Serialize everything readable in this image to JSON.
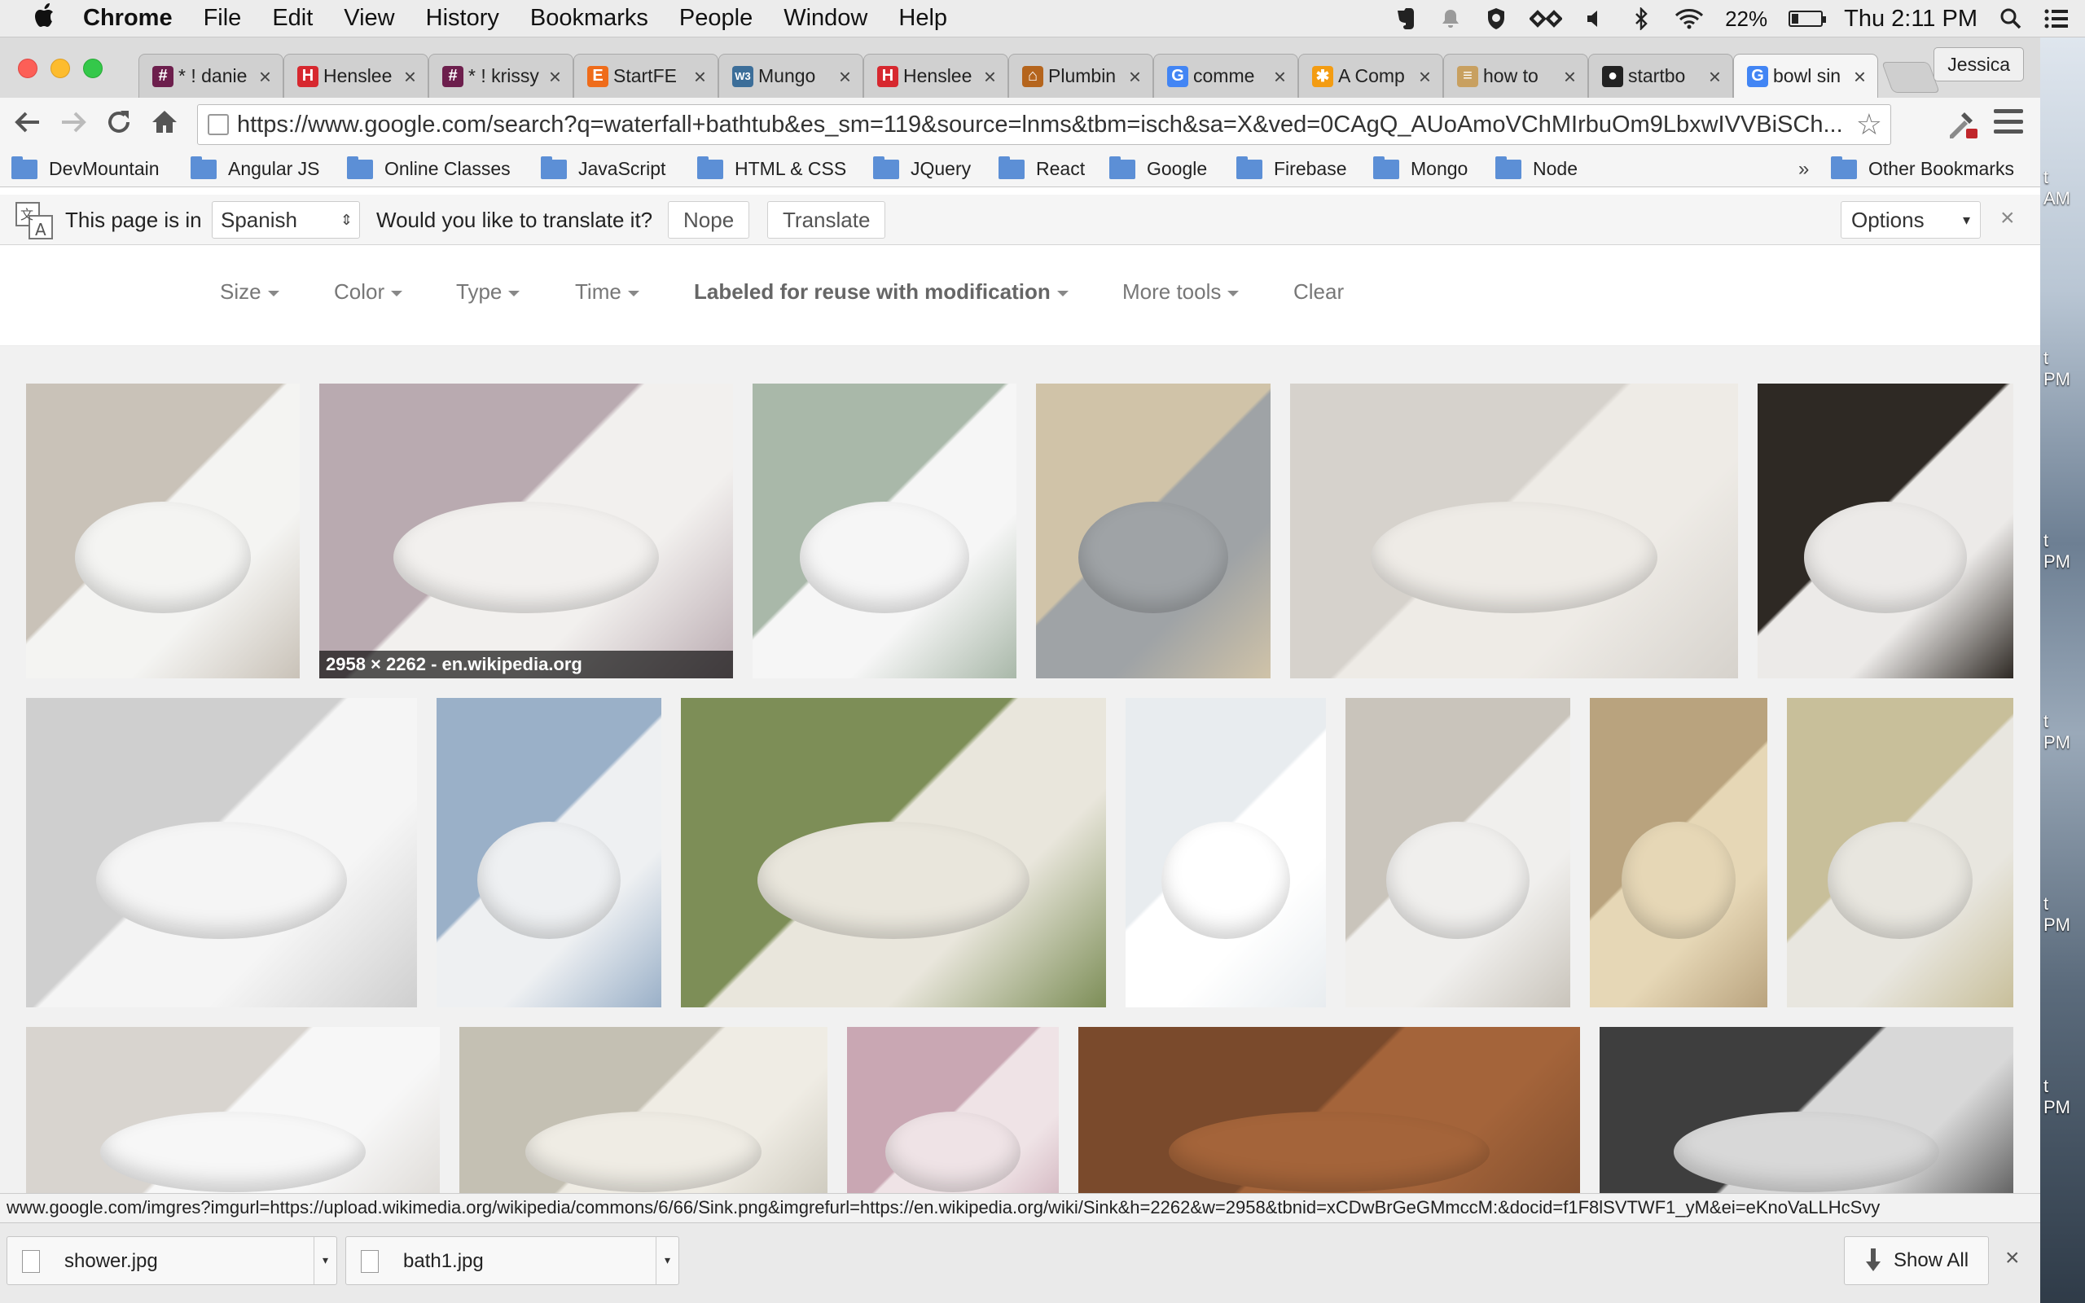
{
  "menubar": {
    "app": "Chrome",
    "items": [
      "File",
      "Edit",
      "View",
      "History",
      "Bookmarks",
      "People",
      "Window",
      "Help"
    ],
    "battery": "22%",
    "battery_level": 0.22,
    "clock": "Thu 2:11 PM"
  },
  "tabs": [
    {
      "title": "* ! danie",
      "favicon": "slack-icon",
      "color": "#6d1f4d",
      "glyph": "#"
    },
    {
      "title": "Henslee",
      "favicon": "h-icon",
      "color": "#d7282f",
      "glyph": "H"
    },
    {
      "title": "* ! krissy",
      "favicon": "slack-icon",
      "color": "#6d1f4d",
      "glyph": "#"
    },
    {
      "title": "StartFE",
      "favicon": "e-icon",
      "color": "#ef6c1a",
      "glyph": "E"
    },
    {
      "title": "Mungo",
      "favicon": "w3-icon",
      "color": "#3c6e99",
      "glyph": "W3"
    },
    {
      "title": "Henslee",
      "favicon": "h-icon",
      "color": "#d7282f",
      "glyph": "H"
    },
    {
      "title": "Plumbin",
      "favicon": "house-icon",
      "color": "#b5651d",
      "glyph": "⌂"
    },
    {
      "title": "comme",
      "favicon": "google-icon",
      "color": "#4285f4",
      "glyph": "G"
    },
    {
      "title": "A Comp",
      "favicon": "asterisk-icon",
      "color": "#f39c12",
      "glyph": "✱"
    },
    {
      "title": "how to",
      "favicon": "doc-icon",
      "color": "#c8a060",
      "glyph": "≡"
    },
    {
      "title": "startbo",
      "favicon": "github-icon",
      "color": "#222222",
      "glyph": "●"
    },
    {
      "title": "bowl sin",
      "favicon": "google-icon",
      "color": "#4285f4",
      "glyph": "G",
      "active": true
    }
  ],
  "profile": "Jessica",
  "omnibox": {
    "url": "https://www.google.com/search?q=waterfall+bathtub&es_sm=119&source=lnms&tbm=isch&sa=X&ved=0CAgQ_AUoAmoVChMIrbuOm9LbxwIVVBiSCh..."
  },
  "bookmarks": [
    "DevMountain",
    "Angular JS",
    "Online Classes",
    "JavaScript",
    "HTML & CSS",
    "JQuery",
    "React",
    "Google",
    "Firebase",
    "Mongo",
    "Node"
  ],
  "bookmarks_overflow": "»",
  "other_bookmarks": "Other Bookmarks",
  "translate": {
    "prefix": "This page is in",
    "language": "Spanish",
    "question": "Would you like to translate it?",
    "nope": "Nope",
    "translate": "Translate",
    "options": "Options"
  },
  "search_tools": [
    "Size",
    "Color",
    "Type",
    "Time",
    "Labeled for reuse with modification",
    "More tools",
    "Clear"
  ],
  "images": [
    {
      "name": "white-vessel-sink-granite",
      "bg": "#c9c2b8",
      "accent": "#f4f4f2"
    },
    {
      "name": "oval-sink-floral-wallpaper",
      "bg": "#b9aab0",
      "accent": "#f2f0ee",
      "caption": "2958 × 2262 - en.wikipedia.org"
    },
    {
      "name": "round-sink-chrome-faucet",
      "bg": "#a9b8a9",
      "accent": "#f6f6f6"
    },
    {
      "name": "stainless-sink-mosaic",
      "bg": "#d0c3a8",
      "accent": "#9fa3a6"
    },
    {
      "name": "white-integrated-sink",
      "bg": "#d6d2cc",
      "accent": "#eeebe6"
    },
    {
      "name": "wall-urinal-trough",
      "bg": "#2e2924",
      "accent": "#eceae8"
    },
    {
      "name": "wall-bidet",
      "bg": "#cfcfcf",
      "accent": "#f5f5f5"
    },
    {
      "name": "toilet-and-bidet-blue-floor",
      "bg": "#9ab0c8",
      "accent": "#eef0f2"
    },
    {
      "name": "vessel-sink-green-wall",
      "bg": "#7d8e57",
      "accent": "#e9e6dc"
    },
    {
      "name": "sink-chrome-faucet-close",
      "bg": "#e8ecef",
      "accent": "#ffffff"
    },
    {
      "name": "toilet-lid-open",
      "bg": "#c9c4bb",
      "accent": "#f0efed"
    },
    {
      "name": "kitchen-sink-cabinets",
      "bg": "#b9a37e",
      "accent": "#e6d7b6"
    },
    {
      "name": "japanese-toilet-tiles",
      "bg": "#c8bf9a",
      "accent": "#e8e6df"
    },
    {
      "name": "utility-sink",
      "bg": "#d8d4cf",
      "accent": "#f7f7f7"
    },
    {
      "name": "urinal-tiles",
      "bg": "#c4c0b3",
      "accent": "#efece4"
    },
    {
      "name": "toilet-pink-tone",
      "bg": "#c9a7b3",
      "accent": "#efe3e6"
    },
    {
      "name": "copper-sink",
      "bg": "#7a4a2c",
      "accent": "#a4643a"
    },
    {
      "name": "sink-dark-tiles",
      "bg": "#3e3e3e",
      "accent": "#d8d8d8"
    }
  ],
  "status_url": "www.google.com/imgres?imgurl=https://upload.wikimedia.org/wikipedia/commons/6/66/Sink.png&imgrefurl=https://en.wikipedia.org/wiki/Sink&h=2262&w=2958&tbnid=xCDwBrGeGMmccM:&docid=f1F8lSVTWF1_yM&ei=eKnoVaLLHcSvy",
  "downloads": [
    {
      "file": "shower.jpg"
    },
    {
      "file": "bath1.jpg"
    }
  ],
  "show_all": "Show All",
  "desktop_labels": [
    "t",
    "AM",
    "t",
    "PM",
    "t",
    "PM",
    "t",
    "PM",
    "t",
    "PM",
    "t",
    "PM"
  ]
}
